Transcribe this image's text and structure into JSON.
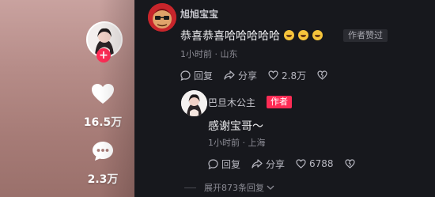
{
  "creator": {
    "like_count": "16.5万",
    "comment_count": "2.3万"
  },
  "comments": [
    {
      "username": "旭旭宝宝",
      "text": "恭喜恭喜哈哈哈哈哈",
      "liked_by_author_tag": "作者赞过",
      "time_location": "1小时前 · 山东",
      "reply_label": "回复",
      "share_label": "分享",
      "like_count": "2.8万"
    }
  ],
  "reply": {
    "username": "巴旦木公主",
    "author_tag": "作者",
    "text": "感谢宝哥～",
    "time_location": "1小时前 · 上海",
    "reply_label": "回复",
    "share_label": "分享",
    "like_count": "6788"
  },
  "expand_label": "展开873条回复",
  "colors": {
    "accent": "#fe2c55",
    "background": "#17181d"
  }
}
